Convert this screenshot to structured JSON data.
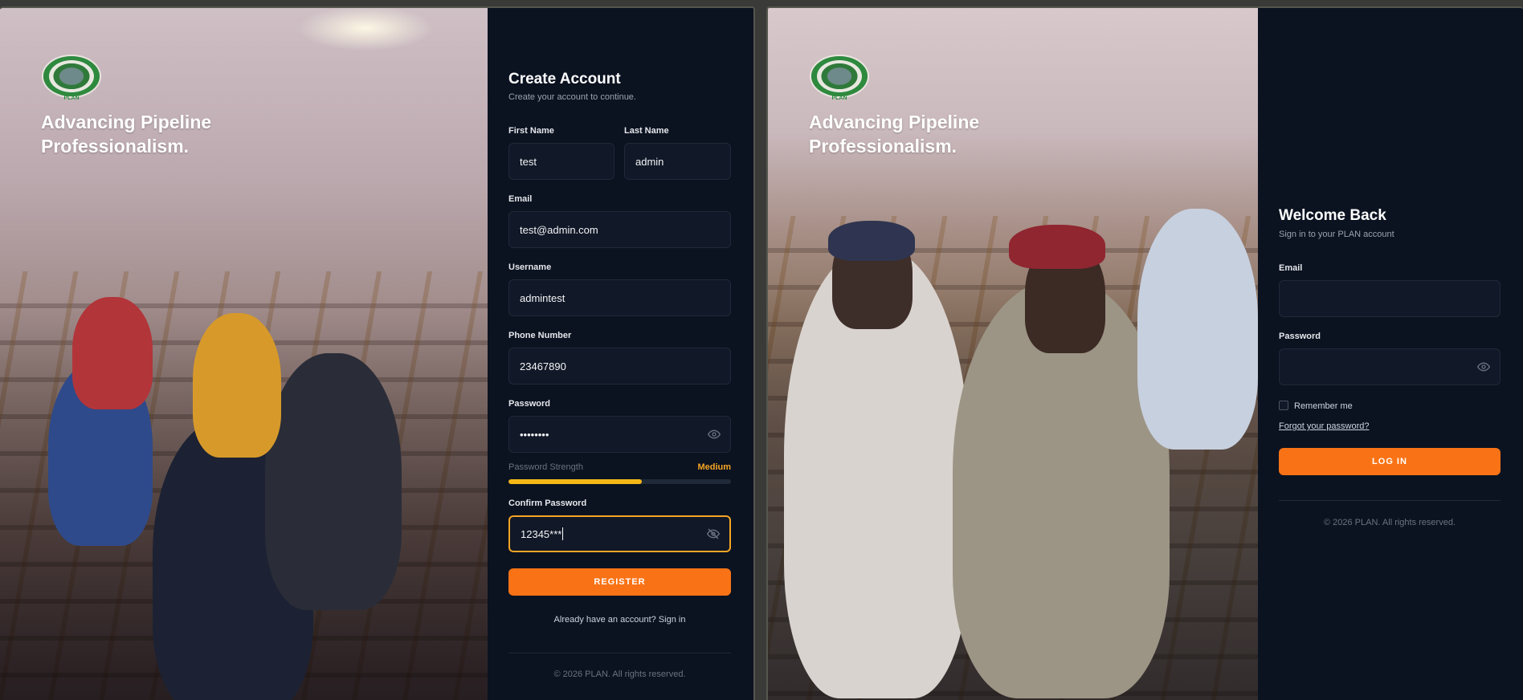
{
  "brand": {
    "logo_text": "PLAN",
    "hero": "Advancing Pipeline Professionalism."
  },
  "register": {
    "title": "Create Account",
    "subtitle": "Create your account to continue.",
    "first_name": {
      "label": "First Name",
      "value": "test"
    },
    "last_name": {
      "label": "Last Name",
      "value": "admin"
    },
    "email": {
      "label": "Email",
      "value": "test@admin.com"
    },
    "username": {
      "label": "Username",
      "value": "admintest"
    },
    "phone": {
      "label": "Phone Number",
      "value": "23467890"
    },
    "password": {
      "label": "Password",
      "value": "••••••••"
    },
    "strength": {
      "label": "Password Strength",
      "value": "Medium",
      "fraction": 0.6
    },
    "confirm_password": {
      "label": "Confirm Password",
      "value": "12345***"
    },
    "register_button": "REGISTER",
    "signin_prompt": "Already have an account? Sign in",
    "footer": "© 2026 PLAN. All rights reserved."
  },
  "login": {
    "title": "Welcome Back",
    "subtitle": "Sign in to your PLAN account",
    "email": {
      "label": "Email",
      "value": ""
    },
    "password": {
      "label": "Password",
      "value": ""
    },
    "remember_label": "Remember me",
    "forgot_link": "Forgot your password?",
    "login_button": "LOG IN",
    "footer": "© 2026 PLAN. All rights reserved."
  },
  "icons": {
    "password_toggle": "eye-icon",
    "confirm_toggle": "eye-off-icon",
    "login_password_toggle": "eye-icon"
  },
  "colors": {
    "accent": "#f97316",
    "focus": "#f5a524",
    "panel": "#0b1220",
    "strength": "#f5b716"
  }
}
